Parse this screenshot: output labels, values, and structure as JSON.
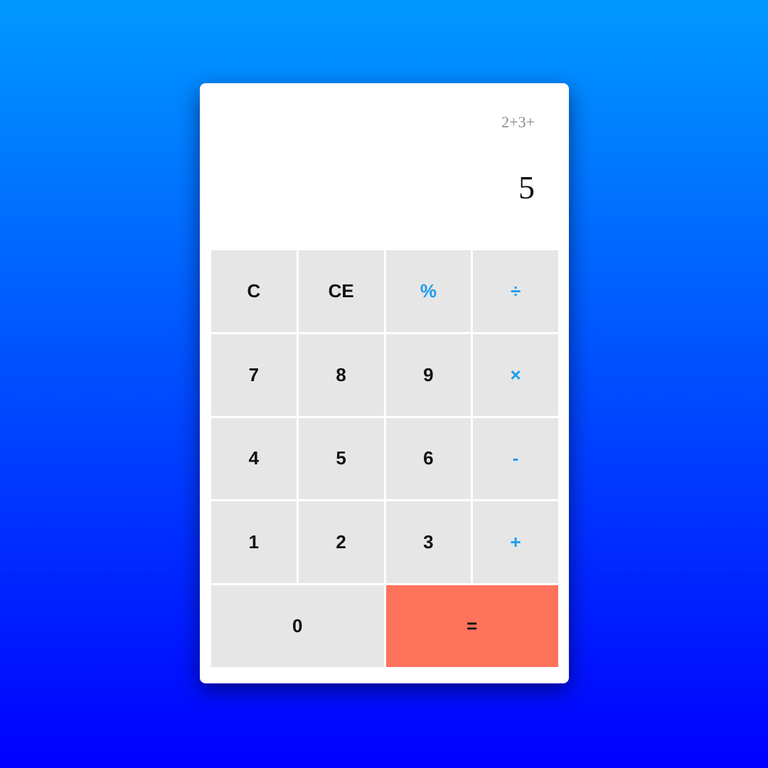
{
  "display": {
    "expression": "2+3+",
    "result": "5"
  },
  "keypad": {
    "rows": [
      [
        {
          "label": "C",
          "name": "clear-button",
          "kind": "func"
        },
        {
          "label": "CE",
          "name": "clear-entry-button",
          "kind": "func"
        },
        {
          "label": "%",
          "name": "percent-button",
          "kind": "op"
        },
        {
          "label": "÷",
          "name": "divide-button",
          "kind": "op"
        }
      ],
      [
        {
          "label": "7",
          "name": "digit-7-button",
          "kind": "digit"
        },
        {
          "label": "8",
          "name": "digit-8-button",
          "kind": "digit"
        },
        {
          "label": "9",
          "name": "digit-9-button",
          "kind": "digit"
        },
        {
          "label": "×",
          "name": "multiply-button",
          "kind": "op"
        }
      ],
      [
        {
          "label": "4",
          "name": "digit-4-button",
          "kind": "digit"
        },
        {
          "label": "5",
          "name": "digit-5-button",
          "kind": "digit"
        },
        {
          "label": "6",
          "name": "digit-6-button",
          "kind": "digit"
        },
        {
          "label": "-",
          "name": "subtract-button",
          "kind": "op"
        }
      ],
      [
        {
          "label": "1",
          "name": "digit-1-button",
          "kind": "digit"
        },
        {
          "label": "2",
          "name": "digit-2-button",
          "kind": "digit"
        },
        {
          "label": "3",
          "name": "digit-3-button",
          "kind": "digit"
        },
        {
          "label": "+",
          "name": "add-button",
          "kind": "op"
        }
      ],
      [
        {
          "label": "0",
          "name": "digit-0-button",
          "kind": "digit"
        },
        {
          "label": "=",
          "name": "equals-button",
          "kind": "equals"
        }
      ]
    ]
  },
  "colors": {
    "background_top": "#0099ff",
    "background_bottom": "#0000ff",
    "operator_text": "#1e9bf0",
    "equals_background": "#ff735c",
    "key_background": "#e6e6e6"
  }
}
